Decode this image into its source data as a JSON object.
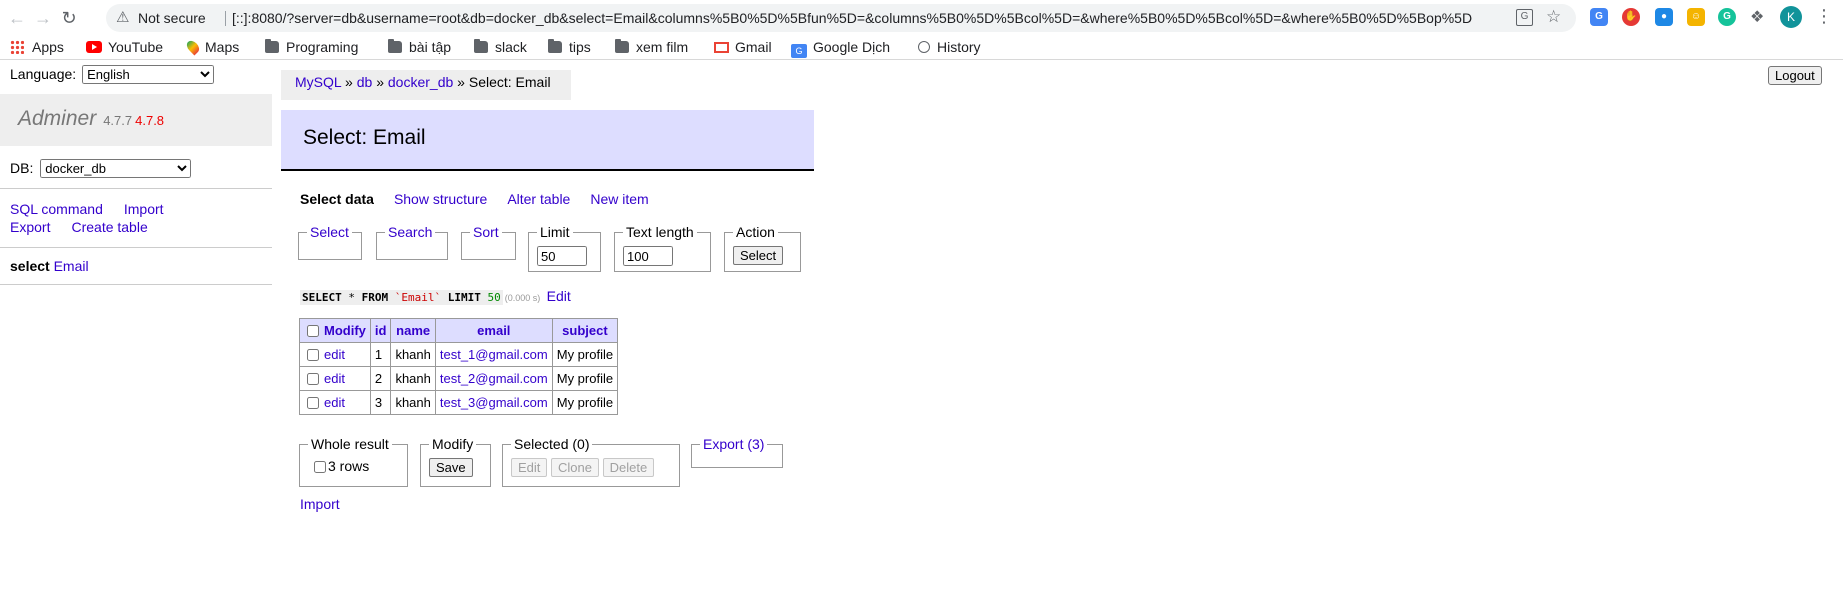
{
  "browser": {
    "not_secure": "Not secure",
    "url": "[::]:8080/?server=db&username=root&db=docker_db&select=Email&columns%5B0%5D%5Bfun%5D=&columns%5B0%5D%5Bcol%5D=&where%5B0%5D%5Bcol%5D=&where%5B0%5D%5Bop%5D=%...",
    "profile_initial": "K",
    "bookmarks": [
      "Apps",
      "YouTube",
      "Maps",
      "Programing",
      "bài tập",
      "slack",
      "tips",
      "xem film",
      "Gmail",
      "Google Dịch",
      "History"
    ]
  },
  "lang": {
    "label": "Language:",
    "selected": "English"
  },
  "logout_label": "Logout",
  "adminer": {
    "name": "Adminer",
    "version": "4.7.7",
    "new_version": "4.7.8"
  },
  "db": {
    "label": "DB:",
    "selected": "docker_db"
  },
  "menu_links": {
    "sql_command": "SQL command",
    "import": "Import",
    "export": "Export",
    "create_table": "Create table"
  },
  "tables": {
    "select_kw": "select",
    "table": "Email"
  },
  "breadcrumb": {
    "driver": "MySQL",
    "server": "db",
    "database": "docker_db",
    "current": "Select: Email",
    "sep": "»"
  },
  "page_title": "Select: Email",
  "tabs": {
    "select_data": "Select data",
    "show_structure": "Show structure",
    "alter_table": "Alter table",
    "new_item": "New item"
  },
  "form": {
    "select": "Select",
    "search": "Search",
    "sort": "Sort",
    "limit_label": "Limit",
    "limit_value": "50",
    "text_length_label": "Text length",
    "text_length_value": "100",
    "action_label": "Action",
    "action_button": "Select"
  },
  "sql": {
    "select": "SELECT",
    "star": "*",
    "from": "FROM",
    "table": "`Email`",
    "limit": "LIMIT",
    "limit_n": "50",
    "time": "(0.000 s)",
    "edit": "Edit"
  },
  "table": {
    "headers": [
      "Modify",
      "id",
      "name",
      "email",
      "subject"
    ],
    "rows": [
      {
        "edit": "edit",
        "id": "1",
        "name": "khanh",
        "email": "test_1@gmail.com",
        "subject": "My profile"
      },
      {
        "edit": "edit",
        "id": "2",
        "name": "khanh",
        "email": "test_2@gmail.com",
        "subject": "My profile"
      },
      {
        "edit": "edit",
        "id": "3",
        "name": "khanh",
        "email": "test_3@gmail.com",
        "subject": "My profile"
      }
    ]
  },
  "bottom": {
    "whole_result": "Whole result",
    "rows": "3 rows",
    "modify": "Modify",
    "save": "Save",
    "selected": "Selected (0)",
    "edit": "Edit",
    "clone": "Clone",
    "delete": "Delete",
    "export": "Export (3)",
    "import": "Import"
  }
}
